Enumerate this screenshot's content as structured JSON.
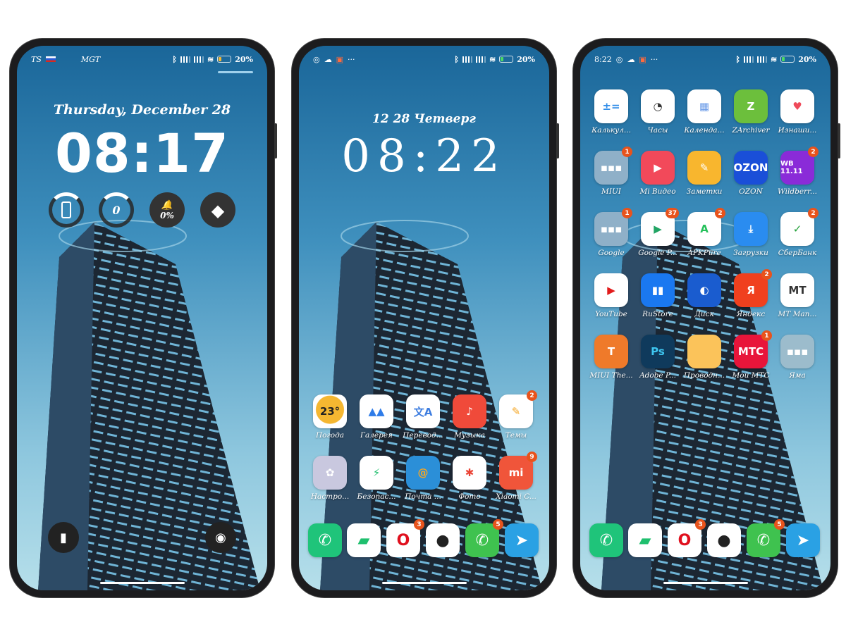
{
  "colors": {
    "badge": "#e8531c",
    "wallpaper_top": "#1a6699",
    "wallpaper_bottom": "#b6dfea"
  },
  "phones": [
    {
      "type": "lockscreen",
      "status": {
        "left1": "TS",
        "left2": "MGT",
        "battery": "20%",
        "battery_level": 0.2
      },
      "date": "Thursday, December 28",
      "time": "08:17",
      "widgets": [
        {
          "icon": "phone-ring-icon",
          "text": ""
        },
        {
          "icon": "gauge-icon",
          "text": "0",
          "sub1": "0",
          "sub2": "0"
        },
        {
          "icon": "bell-icon",
          "text": "0%"
        },
        {
          "icon": "shortcuts-icon",
          "text": ""
        }
      ],
      "bottom": {
        "left": "flashlight-icon",
        "right": "camera-icon"
      }
    },
    {
      "type": "home",
      "status": {
        "icons": [
          "whatsapp-icon",
          "cloud-icon",
          "mi-icon",
          "more-icon"
        ],
        "battery": "20%",
        "battery_level": 0.2
      },
      "date": "12 28 Четверг",
      "time": "08:22",
      "apps": [
        {
          "label": "Погода",
          "glyph": "23°",
          "bg": "#ffffff",
          "fg": "#222",
          "accent": "#f5b731"
        },
        {
          "label": "Галерея",
          "glyph": "▲▲",
          "bg": "#ffffff",
          "fg": "#2f7ce8"
        },
        {
          "label": "Перевод...",
          "glyph": "文A",
          "bg": "#ffffff",
          "fg": "#3d7de0"
        },
        {
          "label": "Музыка",
          "glyph": "♪",
          "bg": "#f04a3a",
          "fg": "#fff"
        },
        {
          "label": "Темы",
          "glyph": "✎",
          "bg": "#ffffff",
          "fg": "#f5a623",
          "badge": "2"
        },
        {
          "label": "Настро...",
          "glyph": "✿",
          "bg": "#c9c8df",
          "fg": "#fff"
        },
        {
          "label": "Безопас...",
          "glyph": "⚡",
          "bg": "#ffffff",
          "fg": "#1fbf6e"
        },
        {
          "label": "Почта ...",
          "glyph": "@",
          "bg": "#2b8fd8",
          "fg": "#f6a623"
        },
        {
          "label": "Фото",
          "glyph": "✱",
          "bg": "#ffffff",
          "fg": "#ea4335"
        },
        {
          "label": "Xiaomi C...",
          "glyph": "mi",
          "bg": "#f0553a",
          "fg": "#fff",
          "badge": "9"
        }
      ],
      "dock": [
        {
          "name": "phone",
          "glyph": "✆",
          "bg": "#1fc47a",
          "fg": "#fff"
        },
        {
          "name": "messages",
          "glyph": "▰",
          "bg": "#ffffff",
          "fg": "#1fbf6e"
        },
        {
          "name": "opera",
          "glyph": "O",
          "bg": "#ffffff",
          "fg": "#e0101e",
          "badge": "3"
        },
        {
          "name": "camera",
          "glyph": "●",
          "bg": "#ffffff",
          "fg": "#222"
        },
        {
          "name": "whatsapp",
          "glyph": "✆",
          "bg": "#3fc24f",
          "fg": "#fff",
          "badge": "5"
        },
        {
          "name": "telegram",
          "glyph": "➤",
          "bg": "#2aa1e4",
          "fg": "#fff"
        }
      ]
    },
    {
      "type": "home",
      "status": {
        "time": "8:22",
        "icons": [
          "whatsapp-icon",
          "cloud-icon",
          "mi-icon",
          "more-icon"
        ],
        "battery": "20%",
        "battery_level": 0.2
      },
      "apps": [
        {
          "label": "Калькул...",
          "glyph": "±=",
          "bg": "#ffffff",
          "fg": "#2f8ce8"
        },
        {
          "label": "Часы",
          "glyph": "◔",
          "bg": "#ffffff",
          "fg": "#333"
        },
        {
          "label": "Календа...",
          "glyph": "▦",
          "bg": "#ffffff",
          "fg": "#6a9be8"
        },
        {
          "label": "ZArchiver",
          "glyph": "Z",
          "bg": "#6cbf3c",
          "fg": "#fff"
        },
        {
          "label": "Изнаши...",
          "glyph": "♥",
          "bg": "#ffffff",
          "fg": "#ef4a5a"
        },
        {
          "label": "MIUI",
          "glyph": "▪▪▪",
          "bg": "#8fb0c8",
          "fg": "#fff",
          "badge": "1"
        },
        {
          "label": "Mi Видео",
          "glyph": "▶",
          "bg": "#f2495a",
          "fg": "#fff"
        },
        {
          "label": "Заметки",
          "glyph": "✎",
          "bg": "#f8b62e",
          "fg": "#fff"
        },
        {
          "label": "OZON",
          "glyph": "OZON",
          "bg": "#1a4fd8",
          "fg": "#fff"
        },
        {
          "label": "Wildberr...",
          "glyph": "WB 11.11",
          "bg": "#8a2bd8",
          "fg": "#fff",
          "badge": "2"
        },
        {
          "label": "Google",
          "glyph": "▪▪▪",
          "bg": "#8fb0c8",
          "fg": "#fff",
          "badge": "1"
        },
        {
          "label": "Google P...",
          "glyph": "▶",
          "bg": "#ffffff",
          "fg": "#21a464",
          "badge": "37"
        },
        {
          "label": "APKPure",
          "glyph": "A",
          "bg": "#ffffff",
          "fg": "#24c05a",
          "badge": "2"
        },
        {
          "label": "Загрузки",
          "glyph": "⤓",
          "bg": "#2a8cf0",
          "fg": "#fff"
        },
        {
          "label": "СберБанк",
          "glyph": "✓",
          "bg": "#ffffff",
          "fg": "#21a038",
          "badge": "2"
        },
        {
          "label": "YouTube",
          "glyph": "▶",
          "bg": "#ffffff",
          "fg": "#e21b1b"
        },
        {
          "label": "RuStore",
          "glyph": "▮▮",
          "bg": "#1a78f0",
          "fg": "#fff"
        },
        {
          "label": "Диск",
          "glyph": "◐",
          "bg": "#1a5ccf",
          "fg": "#fff"
        },
        {
          "label": "Яндекс",
          "glyph": "Я",
          "bg": "#f0401e",
          "fg": "#fff",
          "badge": "2"
        },
        {
          "label": "MT Man...",
          "glyph": "MT",
          "bg": "#ffffff",
          "fg": "#333"
        },
        {
          "label": "MIUI The...",
          "glyph": "T",
          "bg": "#ef7a2a",
          "fg": "#fff"
        },
        {
          "label": "Adobe P...",
          "glyph": "Ps",
          "bg": "#0f3a5c",
          "fg": "#3ec6f0"
        },
        {
          "label": "Проводн...",
          "glyph": "",
          "bg": "#fbc35a",
          "fg": "#fff"
        },
        {
          "label": "Мой МТС",
          "glyph": "МТС",
          "bg": "#e8153a",
          "fg": "#fff",
          "badge": "1"
        },
        {
          "label": "Яма",
          "glyph": "▪▪▪",
          "bg": "#9cbccc",
          "fg": "#fff"
        }
      ],
      "dock": [
        {
          "name": "phone",
          "glyph": "✆",
          "bg": "#1fc47a",
          "fg": "#fff"
        },
        {
          "name": "messages",
          "glyph": "▰",
          "bg": "#ffffff",
          "fg": "#1fbf6e"
        },
        {
          "name": "opera",
          "glyph": "O",
          "bg": "#ffffff",
          "fg": "#e0101e",
          "badge": "3"
        },
        {
          "name": "camera",
          "glyph": "●",
          "bg": "#ffffff",
          "fg": "#222"
        },
        {
          "name": "whatsapp",
          "glyph": "✆",
          "bg": "#3fc24f",
          "fg": "#fff",
          "badge": "5"
        },
        {
          "name": "telegram",
          "glyph": "➤",
          "bg": "#2aa1e4",
          "fg": "#fff"
        }
      ]
    }
  ]
}
